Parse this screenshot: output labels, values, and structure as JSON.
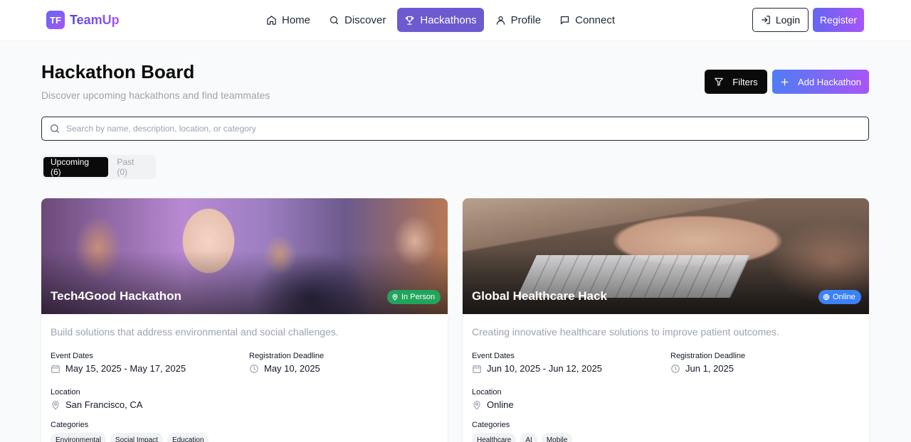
{
  "app": {
    "logo_initials": "TF",
    "name": "TeamUp"
  },
  "nav": {
    "items": [
      {
        "label": "Home",
        "icon": "home-icon"
      },
      {
        "label": "Discover",
        "icon": "search-icon"
      },
      {
        "label": "Hackathons",
        "icon": "trophy-icon",
        "active": true
      },
      {
        "label": "Profile",
        "icon": "user-icon"
      },
      {
        "label": "Connect",
        "icon": "message-icon"
      }
    ],
    "login_label": "Login",
    "register_label": "Register"
  },
  "header": {
    "title": "Hackathon Board",
    "subtitle": "Discover upcoming hackathons and find teammates",
    "filters_label": "Filters",
    "add_label": "Add Hackathon"
  },
  "search": {
    "placeholder": "Search by name, description, location, or category",
    "value": ""
  },
  "tabs": [
    {
      "label": "Upcoming (6)",
      "active": true
    },
    {
      "label": "Past (0)",
      "active": false
    }
  ],
  "labels": {
    "event_dates": "Event Dates",
    "registration_deadline": "Registration Deadline",
    "location": "Location",
    "categories": "Categories"
  },
  "cards": [
    {
      "title": "Tech4Good Hackathon",
      "mode": "In Person",
      "description": "Build solutions that address environmental and social challenges.",
      "event_dates": "May 15, 2025 - May 17, 2025",
      "deadline": "May 10, 2025",
      "location": "San Francisco, CA",
      "categories": [
        "Environmental",
        "Social Impact",
        "Education"
      ]
    },
    {
      "title": "Global Healthcare Hack",
      "mode": "Online",
      "description": "Creating innovative healthcare solutions to improve patient outcomes.",
      "event_dates": "Jun 10, 2025 - Jun 12, 2025",
      "deadline": "Jun 1, 2025",
      "location": "Online",
      "categories": [
        "Healthcare",
        "AI",
        "Mobile"
      ]
    }
  ],
  "colors": {
    "accent": "#6d5acf",
    "in_person_badge": "#22a55b",
    "online_badge": "#3b82f6"
  }
}
